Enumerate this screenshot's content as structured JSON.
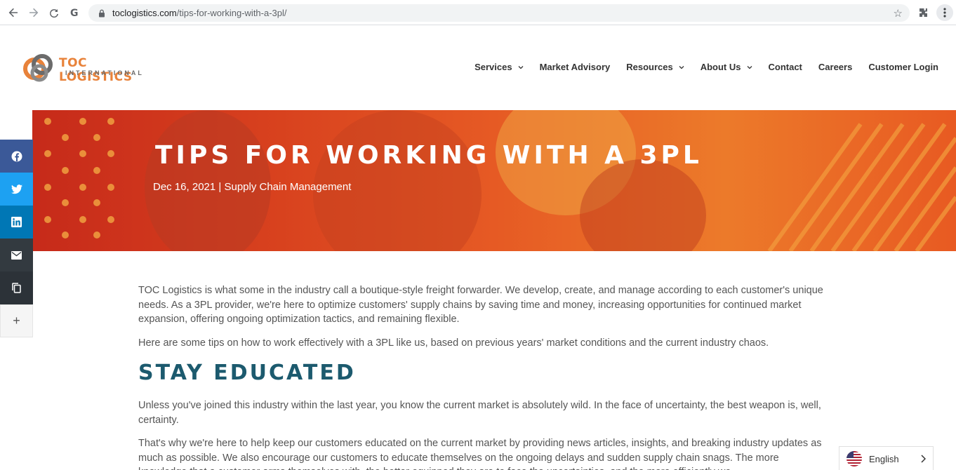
{
  "browser": {
    "url_host": "toclogistics.com",
    "url_path": "/tips-for-working-with-a-3pl/"
  },
  "logo": {
    "main": "TOC LOGISTICS",
    "sub": "INTERNATIONAL"
  },
  "nav": {
    "items": [
      {
        "label": "Services",
        "has_dropdown": true
      },
      {
        "label": "Market Advisory",
        "has_dropdown": false
      },
      {
        "label": "Resources",
        "has_dropdown": true
      },
      {
        "label": "About Us",
        "has_dropdown": true
      },
      {
        "label": "Contact",
        "has_dropdown": false
      },
      {
        "label": "Careers",
        "has_dropdown": false
      },
      {
        "label": "Customer Login",
        "has_dropdown": false
      }
    ]
  },
  "hero": {
    "title": "TIPS FOR WORKING WITH A 3PL",
    "date": "Dec 16, 2021",
    "separator": " | ",
    "category": "Supply Chain Management"
  },
  "social": {
    "icons": [
      "facebook-icon",
      "twitter-icon",
      "linkedin-icon",
      "email-icon",
      "copy-icon",
      "plus-icon"
    ],
    "colors": {
      "facebook": "#3b5998",
      "twitter": "#1da1f2",
      "linkedin": "#0077b5",
      "email": "#333a40"
    }
  },
  "article": {
    "p1": "TOC Logistics is what some in the industry call a boutique-style freight forwarder. We develop, create, and manage according to each customer's unique needs. As a 3PL provider, we're here to optimize customers' supply chains by saving time and money, increasing opportunities for continued market expansion, offering ongoing optimization tactics, and remaining flexible.",
    "p2": "Here are some tips on how to work effectively with a 3PL like us, based on previous years' market conditions and the current industry chaos.",
    "h1": "STAY EDUCATED",
    "p3": "Unless you've joined this industry within the last year, you know the current market is absolutely wild. In the face of uncertainty, the best weapon is, well, certainty.",
    "p4": "That's why we're here to help keep our customers educated on the current market by providing news articles, insights, and breaking industry updates as much as possible. We also encourage our customers to educate themselves on the ongoing delays and sudden supply chain snags. The more knowledge that a customer arms themselves with, the better equipped they are to face the uncertainties, and the more efficiently we"
  },
  "language": {
    "label": "English"
  },
  "colors": {
    "brand_orange": "#e8823a",
    "heading_teal": "#1c5a6e"
  }
}
